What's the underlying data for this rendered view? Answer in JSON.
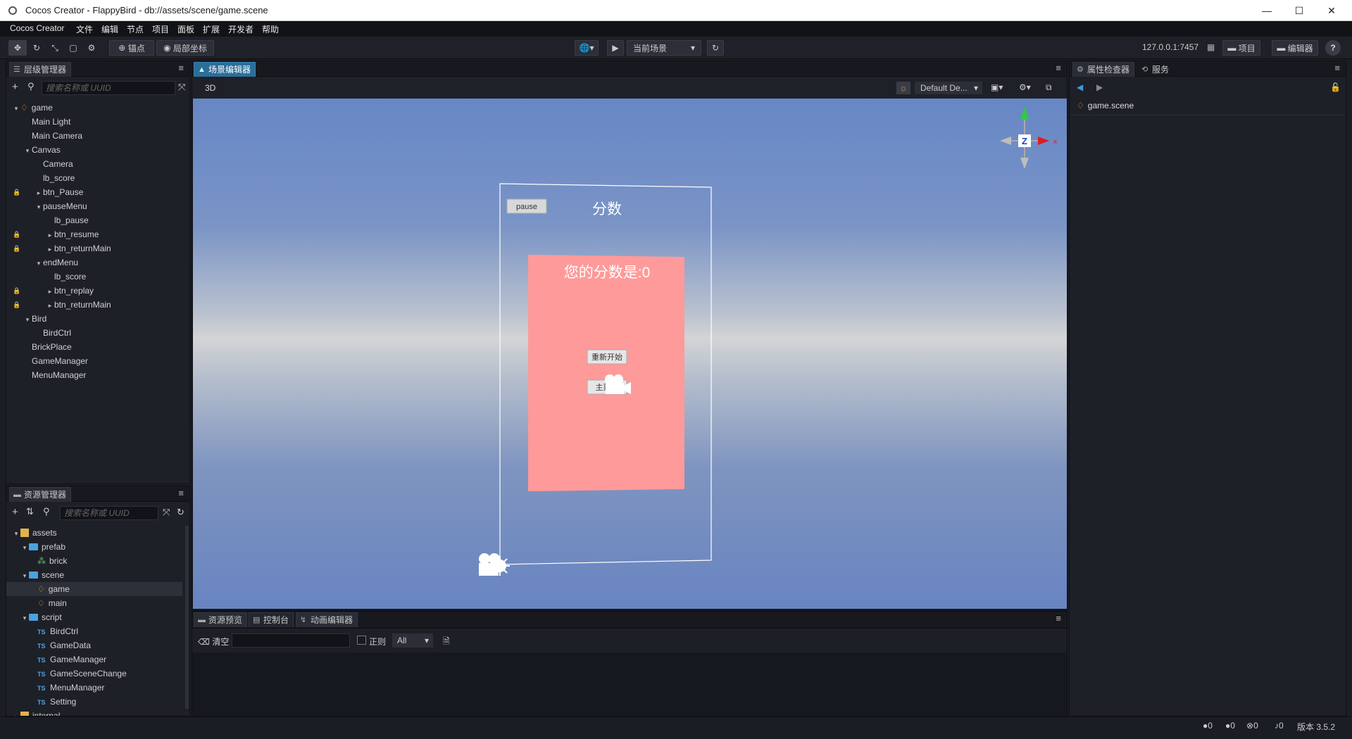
{
  "window": {
    "title": "Cocos Creator - FlappyBird - db://assets/scene/game.scene",
    "minimize": "—",
    "maximize": "☐",
    "close": "✕"
  },
  "menubar": [
    "Cocos Creator",
    "文件",
    "编辑",
    "节点",
    "项目",
    "面板",
    "扩展",
    "开发者",
    "帮助"
  ],
  "toolbar": {
    "pivot_label": "锚点",
    "local_label": "局部坐标",
    "scene_select": "当前场景",
    "server": "127.0.0.1:7457",
    "project_btn": "项目",
    "editor_btn": "编辑器",
    "help": "?"
  },
  "hierarchy": {
    "tab": "层级管理器",
    "search_placeholder": "搜索名称或 UUID",
    "items": [
      {
        "label": "game",
        "depth": 0,
        "caret": "▾",
        "lock": false,
        "icon": "scene"
      },
      {
        "label": "Main Light",
        "depth": 1,
        "caret": "",
        "lock": false
      },
      {
        "label": "Main Camera",
        "depth": 1,
        "caret": "",
        "lock": false
      },
      {
        "label": "Canvas",
        "depth": 1,
        "caret": "▾",
        "lock": false
      },
      {
        "label": "Camera",
        "depth": 2,
        "caret": "",
        "lock": false
      },
      {
        "label": "lb_score",
        "depth": 2,
        "caret": "",
        "lock": false
      },
      {
        "label": "btn_Pause",
        "depth": 2,
        "caret": "▸",
        "lock": true
      },
      {
        "label": "pauseMenu",
        "depth": 2,
        "caret": "▾",
        "lock": false
      },
      {
        "label": "lb_pause",
        "depth": 3,
        "caret": "",
        "lock": false
      },
      {
        "label": "btn_resume",
        "depth": 3,
        "caret": "▸",
        "lock": true
      },
      {
        "label": "btn_returnMain",
        "depth": 3,
        "caret": "▸",
        "lock": true
      },
      {
        "label": "endMenu",
        "depth": 2,
        "caret": "▾",
        "lock": false
      },
      {
        "label": "lb_score",
        "depth": 3,
        "caret": "",
        "lock": false
      },
      {
        "label": "btn_replay",
        "depth": 3,
        "caret": "▸",
        "lock": true
      },
      {
        "label": "btn_returnMain",
        "depth": 3,
        "caret": "▸",
        "lock": true
      },
      {
        "label": "Bird",
        "depth": 1,
        "caret": "▾",
        "lock": false
      },
      {
        "label": "BirdCtrl",
        "depth": 2,
        "caret": "",
        "lock": false
      },
      {
        "label": "BrickPlace",
        "depth": 1,
        "caret": "",
        "lock": false
      },
      {
        "label": "GameManager",
        "depth": 1,
        "caret": "",
        "lock": false
      },
      {
        "label": "MenuManager",
        "depth": 1,
        "caret": "",
        "lock": false
      }
    ]
  },
  "assets": {
    "tab": "资源管理器",
    "search_placeholder": "搜索名称或 UUID",
    "items": [
      {
        "label": "assets",
        "depth": 0,
        "caret": "▾",
        "icon": "db"
      },
      {
        "label": "prefab",
        "depth": 1,
        "caret": "▾",
        "icon": "folder"
      },
      {
        "label": "brick",
        "depth": 2,
        "caret": "",
        "icon": "prefab"
      },
      {
        "label": "scene",
        "depth": 1,
        "caret": "▾",
        "icon": "folder"
      },
      {
        "label": "game",
        "depth": 2,
        "caret": "",
        "icon": "scene",
        "selected": true
      },
      {
        "label": "main",
        "depth": 2,
        "caret": "",
        "icon": "scene"
      },
      {
        "label": "script",
        "depth": 1,
        "caret": "▾",
        "icon": "folder"
      },
      {
        "label": "BirdCtrl",
        "depth": 2,
        "caret": "",
        "icon": "ts"
      },
      {
        "label": "GameData",
        "depth": 2,
        "caret": "",
        "icon": "ts"
      },
      {
        "label": "GameManager",
        "depth": 2,
        "caret": "",
        "icon": "ts"
      },
      {
        "label": "GameSceneChange",
        "depth": 2,
        "caret": "",
        "icon": "ts"
      },
      {
        "label": "MenuManager",
        "depth": 2,
        "caret": "",
        "icon": "ts"
      },
      {
        "label": "Setting",
        "depth": 2,
        "caret": "",
        "icon": "ts"
      },
      {
        "label": "internal",
        "depth": 0,
        "caret": "▸",
        "icon": "db"
      }
    ]
  },
  "scene_editor": {
    "tab": "场景编辑器",
    "mode_3d": "3D",
    "layout_select": "Default De...",
    "gizmo_axis_z": "Z",
    "gizmo_axis_x": "x",
    "canvas": {
      "pause_button": "pause",
      "score_title": "分数",
      "end_score_text": "您的分数是:0",
      "restart_button": "重新开始",
      "main_button": "主菜单",
      "camera_label": "Cam"
    }
  },
  "inspector": {
    "tab": "属性检查器",
    "service_tab": "服务",
    "asset_name": "game.scene"
  },
  "bottom_panel": {
    "tabs": [
      "资源预览",
      "控制台",
      "动画编辑器"
    ],
    "clear_label": "清空",
    "regex_label": "正则",
    "filter_select": "All"
  },
  "statusbar": {
    "errors": "0",
    "warnings": "0",
    "infos": "0",
    "notices": "0",
    "version": "版本 3.5.2"
  }
}
